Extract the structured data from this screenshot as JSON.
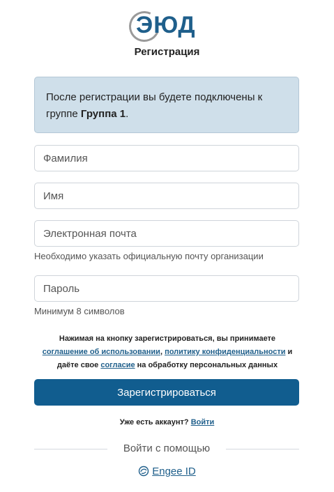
{
  "brand": {
    "logo_text": "ЭЮД"
  },
  "page": {
    "title": "Регистрация"
  },
  "info": {
    "text_before": "После регистрации вы будете подключены к группе ",
    "group_name": "Группа 1",
    "text_after": "."
  },
  "form": {
    "last_name": {
      "placeholder": "Фамилия",
      "value": ""
    },
    "first_name": {
      "placeholder": "Имя",
      "value": ""
    },
    "email": {
      "placeholder": "Электронная почта",
      "value": "",
      "hint": "Необходимо указать официальную почту организации"
    },
    "password": {
      "placeholder": "Пароль",
      "value": "",
      "hint": "Минимум 8 символов"
    }
  },
  "terms": {
    "line1": "Нажимая на кнопку зарегистрироваться, вы принимаете",
    "agreement_link": "соглашение об использовании",
    "comma": ", ",
    "privacy_link": "политику конфиденциальности",
    "and": " и",
    "line3_before": "даёте свое ",
    "consent_link": "согласие",
    "line3_after": " на обработку персональных данных"
  },
  "actions": {
    "submit_label": "Зарегистрироваться"
  },
  "login": {
    "question": "Уже есть аккаунт? ",
    "link": "Войти"
  },
  "alt_login": {
    "divider_label": "Войти с помощью",
    "engee_label": "Engee ID"
  },
  "colors": {
    "accent": "#115d8f",
    "link": "#1f5f8b",
    "info_bg": "#cfdfea"
  }
}
